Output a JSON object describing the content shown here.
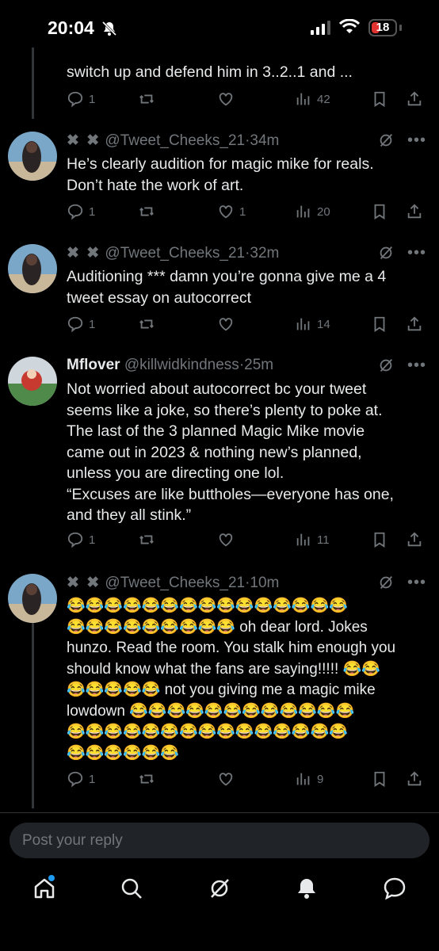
{
  "status_bar": {
    "time": "20:04",
    "battery": "18"
  },
  "colors": {
    "background": "#000000",
    "text": "#e7e9ea",
    "muted": "#71767b",
    "accent": "#1d9bf0",
    "battery_low": "#e0332f"
  },
  "tweets": [
    {
      "text": "switch up and defend him in 3..2..1 and ...",
      "replies": "1",
      "likes": "",
      "views": "42"
    },
    {
      "author_handle": "@Tweet_Cheeks_21",
      "sep": "·",
      "time": "34m",
      "text": "He’s clearly audition for magic mike for reals.\nDon’t hate the work of art.",
      "replies": "1",
      "likes": "1",
      "views": "20"
    },
    {
      "author_handle": "@Tweet_Cheeks_21",
      "sep": "·",
      "time": "32m",
      "text": "Auditioning *** damn you’re gonna give me a 4\ntweet essay on autocorrect",
      "replies": "1",
      "likes": "",
      "views": "14"
    },
    {
      "author_name": "Mflover",
      "author_handle": "@killwidkindness",
      "sep": "·",
      "time": "25m",
      "text": "Not worried about autocorrect bc your tweet\nseems like a joke, so there’s plenty to poke at.\nThe last of the 3 planned Magic Mike movie\ncame out in 2023 & nothing new’s planned,\nunless you are directing one lol.\n“Excuses are like buttholes—everyone has one,\nand they all stink.”",
      "replies": "1",
      "likes": "",
      "views": "11"
    },
    {
      "author_handle": "@Tweet_Cheeks_21",
      "sep": "·",
      "time": "10m",
      "text": "😂😂😂😂😂😂😂😂😂😂😂😂😂😂😂\n😂😂😂😂😂😂😂😂😂 oh dear lord. Jokes\nhunzo. Read the room. You stalk him enough you\nshould know what the fans are saying!!!!! 😂😂\n😂😂😂😂😂 not you giving me a magic mike\nlowdown 😂😂😂😂😂😂😂😂😂😂😂😂\n😂😂😂😂😂😂😂😂😂😂😂😂😂😂😂\n😂😂😂😂😂😂",
      "replies": "1",
      "likes": "",
      "views": "9"
    }
  ],
  "reply_box": {
    "placeholder": "Post your reply"
  },
  "icons": [
    "reply-icon",
    "repost-icon",
    "like-icon",
    "views-icon",
    "bookmark-icon",
    "share-icon",
    "grok-icon",
    "more-icon",
    "home-icon",
    "search-icon",
    "grok-tab-icon",
    "notifications-icon",
    "messages-icon"
  ]
}
